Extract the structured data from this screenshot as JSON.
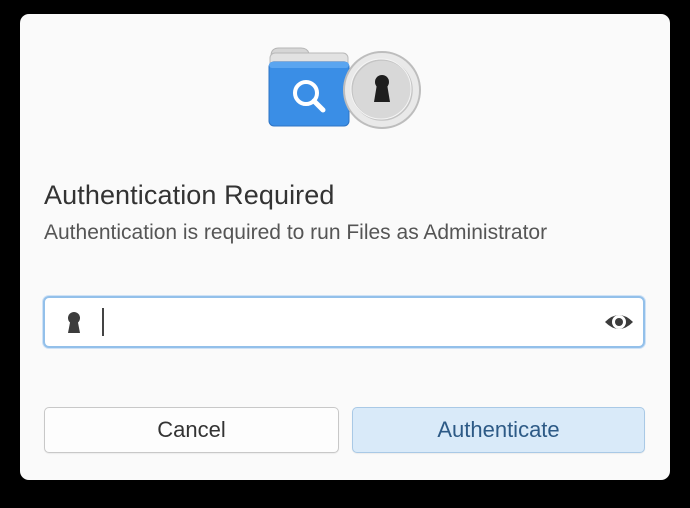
{
  "dialog": {
    "icon": "folder-search-with-keyhole-lock-icon",
    "title": "Authentication Required",
    "message": "Authentication is required to run Files as Administrator",
    "password_field": {
      "value": "",
      "placeholder": "",
      "leading_icon": "keyhole-icon",
      "trailing_icon": "eye-icon"
    },
    "buttons": {
      "cancel_label": "Cancel",
      "authenticate_label": "Authenticate"
    }
  },
  "colors": {
    "accent": "#3b8de0",
    "focus_border": "#93c0ea",
    "suggested_button_bg": "#d9eaf9",
    "suggested_button_text": "#2d5a86",
    "dialog_bg": "#fafafa"
  }
}
